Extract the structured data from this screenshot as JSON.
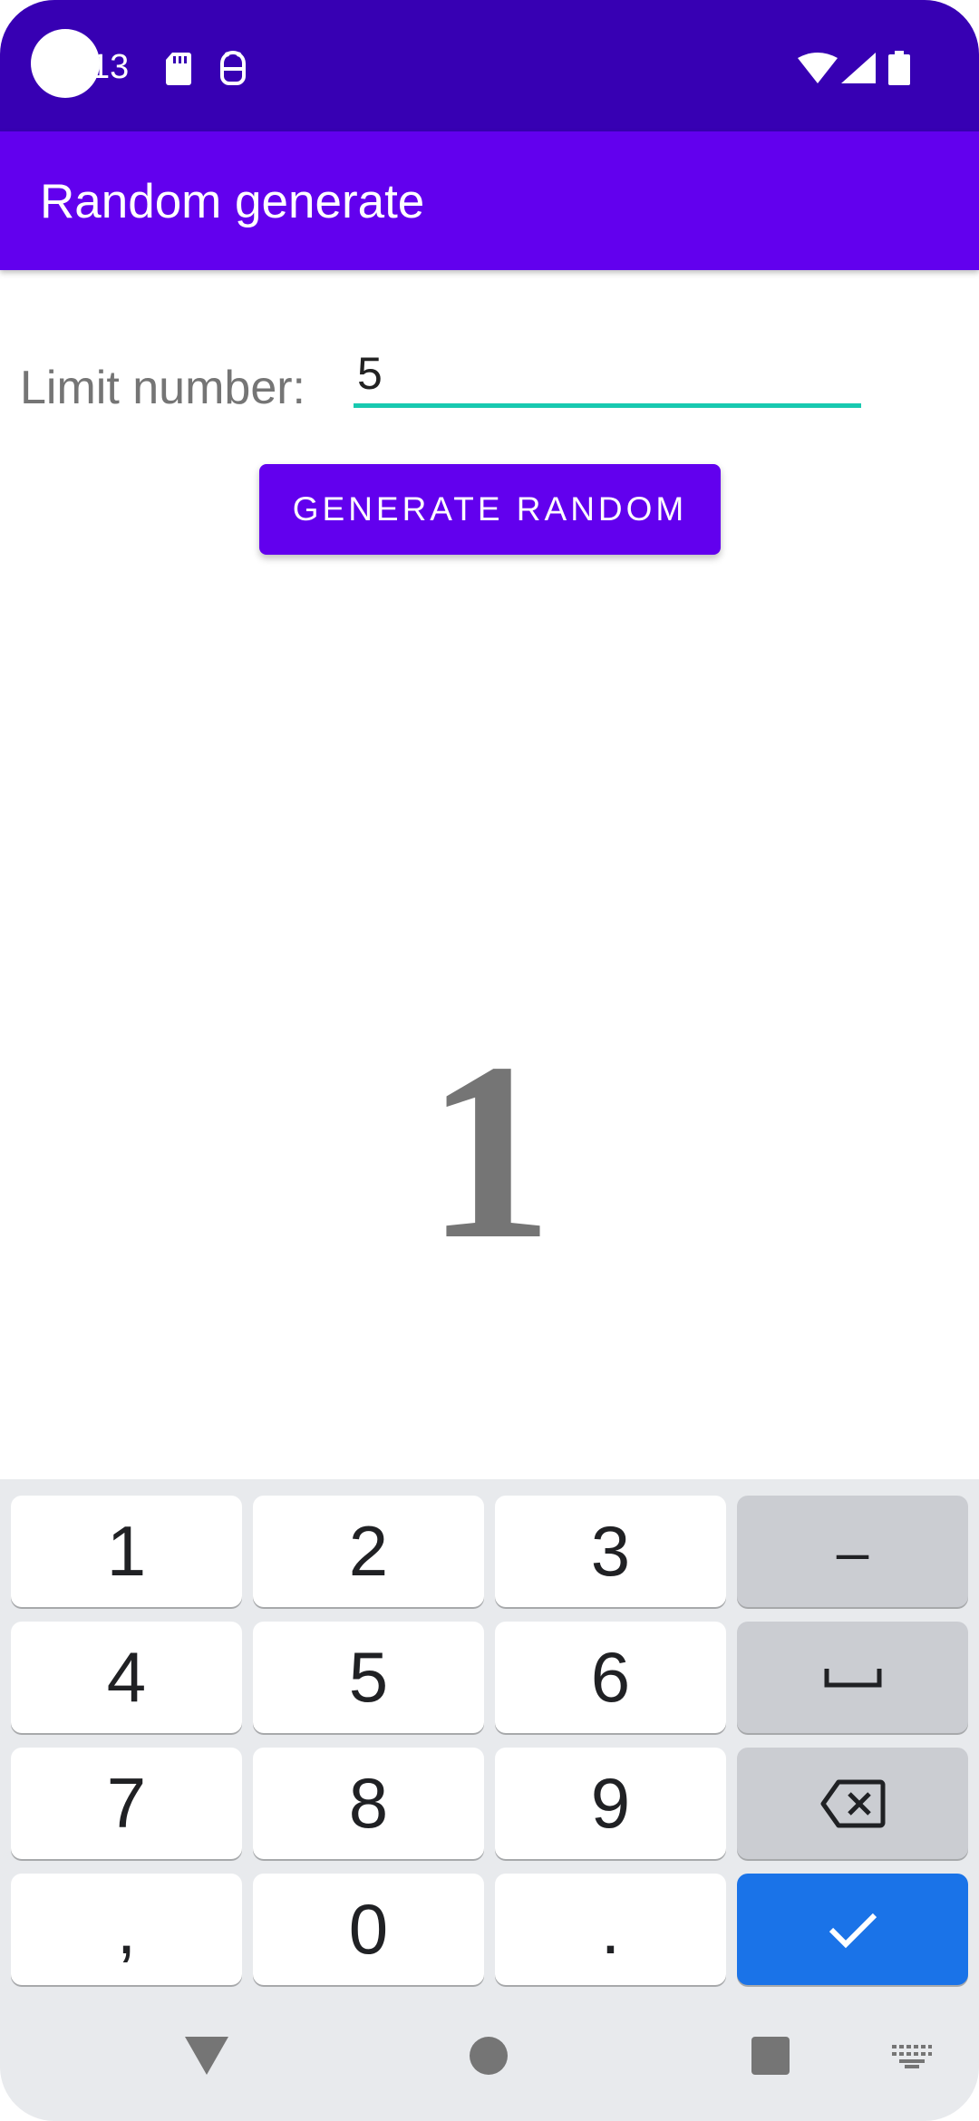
{
  "status_bar": {
    "time": "13",
    "icons": [
      "sd-card-icon",
      "android-debug-icon",
      "wifi-icon",
      "signal-icon",
      "battery-icon"
    ]
  },
  "app_bar": {
    "title": "Random generate"
  },
  "form": {
    "limit_label": "Limit number:",
    "limit_value": "5",
    "generate_button_label": "GENERATE RANDOM"
  },
  "result": {
    "value": "1"
  },
  "keyboard": {
    "keys": [
      "1",
      "2",
      "3",
      "–",
      "4",
      "5",
      "6",
      "7",
      "8",
      "9",
      ",",
      "0",
      "."
    ],
    "action_icons": [
      "space-icon",
      "backspace-icon",
      "check-icon"
    ]
  },
  "nav_bar": {
    "icons": [
      "back-icon",
      "home-icon",
      "recents-icon",
      "keyboard-switch-icon"
    ]
  },
  "colors": {
    "status_bar": "#3700B3",
    "app_bar": "#6200EE",
    "button": "#6200EE",
    "input_underline": "#18C9B0",
    "result_text": "#757575",
    "keyboard_bg": "#E8EAED",
    "key_action": "#1A73E8"
  }
}
